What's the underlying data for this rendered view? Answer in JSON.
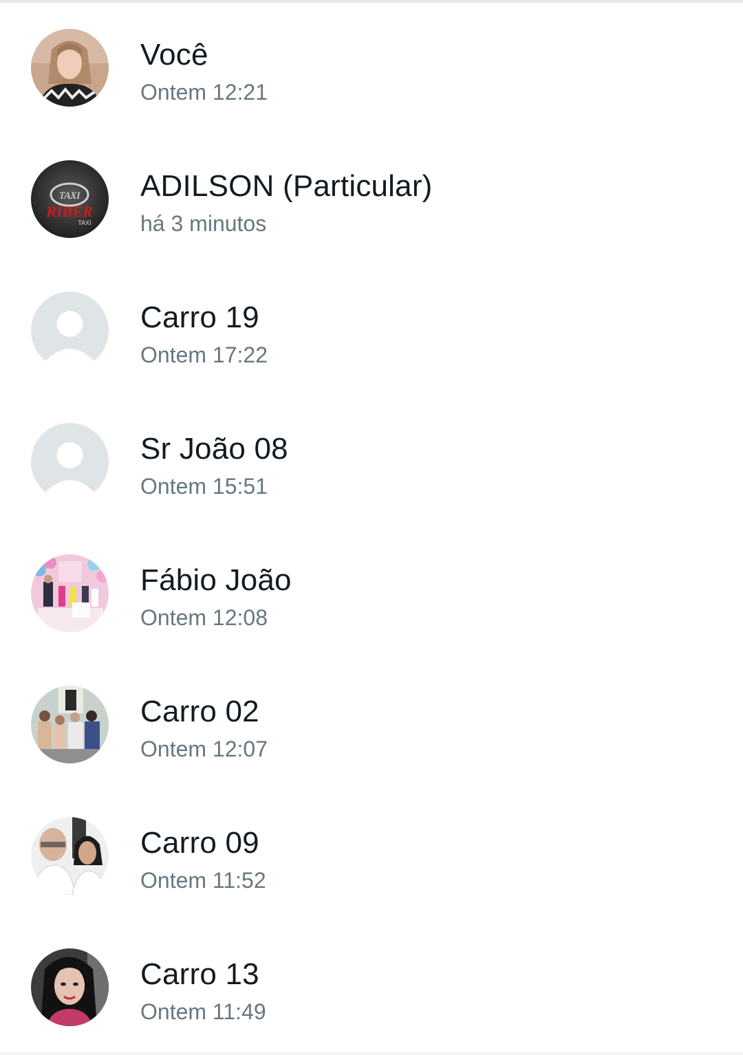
{
  "viewers": [
    {
      "name": "Você",
      "time": "Ontem 12:21",
      "avatar": "photo-woman-blonde"
    },
    {
      "name": "ADILSON (Particular)",
      "time": "há 3 minutos",
      "avatar": "taxi-logo"
    },
    {
      "name": "Carro 19",
      "time": "Ontem 17:22",
      "avatar": "default-person-icon"
    },
    {
      "name": "Sr João 08",
      "time": "Ontem 15:51",
      "avatar": "default-person-icon"
    },
    {
      "name": "Fábio João",
      "time": "Ontem 12:08",
      "avatar": "photo-party"
    },
    {
      "name": "Carro 02",
      "time": "Ontem 12:07",
      "avatar": "photo-family"
    },
    {
      "name": "Carro 09",
      "time": "Ontem 11:52",
      "avatar": "photo-couple"
    },
    {
      "name": "Carro 13",
      "time": "Ontem 11:49",
      "avatar": "photo-woman-dark-hair"
    }
  ],
  "logo_text": {
    "top": "TAXI",
    "middle": "RIBER",
    "bottom": "TAXI"
  },
  "colors": {
    "name_text": "#111b21",
    "time_text": "#667781",
    "default_avatar_bg": "#dfe5e7",
    "default_avatar_fg": "#ffffff"
  }
}
